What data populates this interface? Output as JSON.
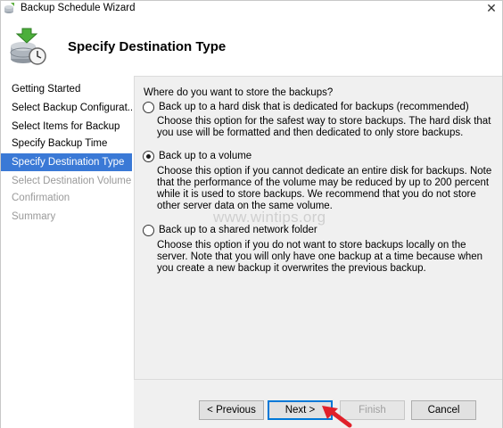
{
  "window": {
    "title": "Backup Schedule Wizard",
    "close_glyph": "✕"
  },
  "header": {
    "title": "Specify Destination Type"
  },
  "sidebar": {
    "items": [
      {
        "label": "Getting Started",
        "state": "normal"
      },
      {
        "label": "Select Backup Configurat...",
        "state": "normal"
      },
      {
        "label": "Select Items for Backup",
        "state": "normal"
      },
      {
        "label": "Specify Backup Time",
        "state": "normal"
      },
      {
        "label": "Specify Destination Type",
        "state": "active"
      },
      {
        "label": "Select Destination Volume",
        "state": "disabled"
      },
      {
        "label": "Confirmation",
        "state": "disabled"
      },
      {
        "label": "Summary",
        "state": "disabled"
      }
    ]
  },
  "main": {
    "question": "Where do you want to store the backups?",
    "options": [
      {
        "label": "Back up to a hard disk that is dedicated for backups (recommended)",
        "description": "Choose this option for the safest way to store backups. The hard disk that you use will be formatted and then dedicated to only store backups.",
        "selected": false
      },
      {
        "label": "Back up to a volume",
        "description": "Choose this option if you cannot dedicate an entire disk for backups. Note that the performance of the volume may be reduced by up to 200 percent while it is used to store backups. We recommend that you do not store other server data on the same volume.",
        "selected": true
      },
      {
        "label": "Back up to a shared network folder",
        "description": "Choose this option if you do not want to store backups locally on the server. Note that you will only have one backup at a time because when you create a new backup it overwrites the previous backup.",
        "selected": false
      }
    ],
    "watermark": "www.wintips.org"
  },
  "footer": {
    "previous_label": "< Previous",
    "next_label": "Next >",
    "finish_label": "Finish",
    "cancel_label": "Cancel"
  },
  "colors": {
    "accent": "#3a79d6",
    "primary_border": "#0078d7",
    "arrow": "#e0202a"
  },
  "icons": {
    "app": "backup-wizard-icon",
    "header": "backup-clock-icon",
    "pointer": "red-arrow-icon"
  }
}
